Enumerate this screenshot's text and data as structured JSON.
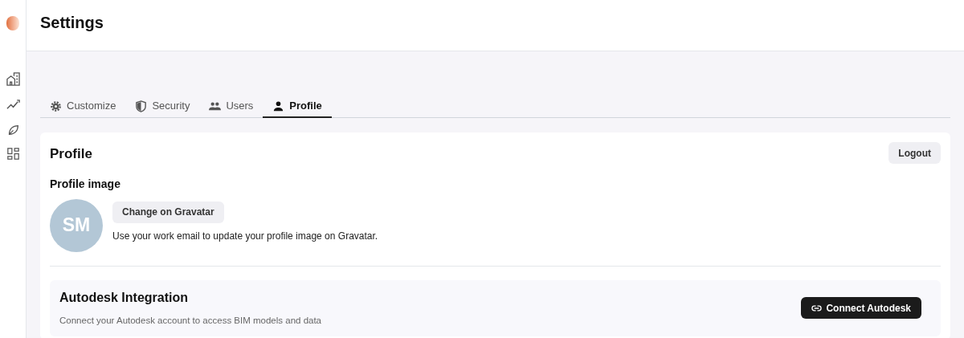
{
  "header": {
    "title": "Settings"
  },
  "tabs": [
    {
      "label": "Customize",
      "selected": false
    },
    {
      "label": "Security",
      "selected": false
    },
    {
      "label": "Users",
      "selected": false
    },
    {
      "label": "Profile",
      "selected": true
    }
  ],
  "profile": {
    "title": "Profile",
    "logout": "Logout",
    "image_heading": "Profile image",
    "avatar_initials": "SM",
    "gravatar_button": "Change on Gravatar",
    "gravatar_hint": "Use your work email to update your profile image on Gravatar."
  },
  "integration": {
    "title": "Autodesk Integration",
    "description": "Connect your Autodesk account to access BIM models and data",
    "button": "Connect Autodesk"
  }
}
